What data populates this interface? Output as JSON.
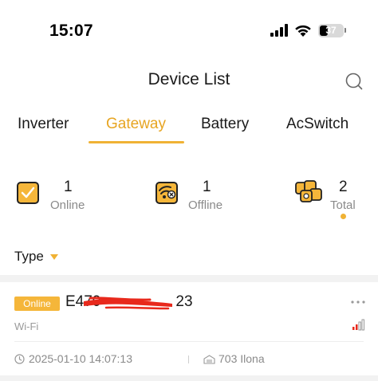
{
  "status_bar": {
    "time": "15:07",
    "battery_level": "37",
    "icons": [
      "cellular-signal-icon",
      "wifi-icon",
      "battery-icon"
    ]
  },
  "header": {
    "title": "Device List",
    "search_icon": "search-icon"
  },
  "tabs": [
    {
      "label": "Inverter",
      "active": false
    },
    {
      "label": "Gateway",
      "active": true
    },
    {
      "label": "Battery",
      "active": false
    },
    {
      "label": "AcSwitch",
      "active": false
    }
  ],
  "stats": {
    "online": {
      "count": "1",
      "label": "Online",
      "icon": "online-check-icon"
    },
    "offline": {
      "count": "1",
      "label": "Offline",
      "icon": "offline-gateway-icon"
    },
    "total": {
      "count": "2",
      "label": "Total",
      "icon": "total-devices-icon",
      "selected": true
    }
  },
  "filter": {
    "label": "Type",
    "icon": "caret-down-icon"
  },
  "devices": [
    {
      "status": "Online",
      "serial_visible": "E470",
      "serial_suffix": "23",
      "connection": "Wi-Fi",
      "timestamp": "2025-01-10 14:07:13",
      "plant": "703 Ilona"
    }
  ],
  "colors": {
    "accent": "#f0b234",
    "accent_text": "#e7a522",
    "redaction": "#e8291c",
    "muted_text": "#8a8a8a"
  }
}
